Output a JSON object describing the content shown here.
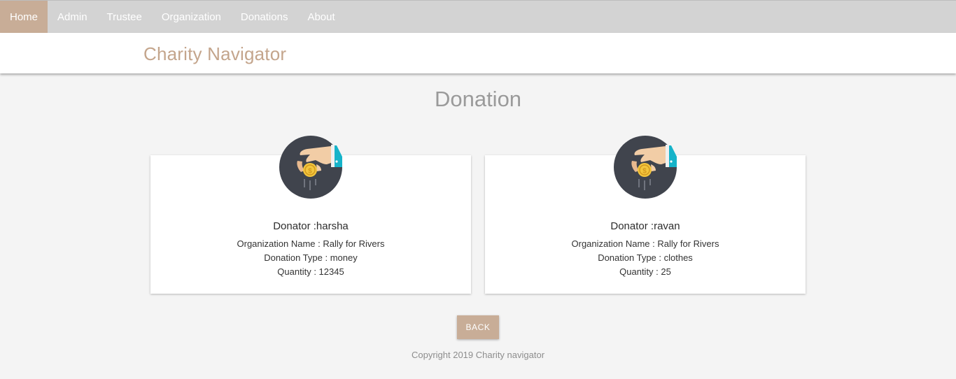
{
  "nav": {
    "items": [
      {
        "label": "Home",
        "active": true
      },
      {
        "label": "Admin"
      },
      {
        "label": "Trustee"
      },
      {
        "label": "Organization"
      },
      {
        "label": "Donations"
      },
      {
        "label": "About"
      }
    ]
  },
  "header": {
    "brand": "Charity Navigator"
  },
  "main": {
    "title": "Donation",
    "cards": [
      {
        "icon": "hand-coin-icon",
        "donor": "Donator :harsha",
        "organization": "Organization Name : Rally for Rivers",
        "type": "Donation Type : money",
        "quantity": "Quantity : 12345"
      },
      {
        "icon": "hand-coin-icon",
        "donor": "Donator :ravan",
        "organization": "Organization Name : Rally for Rivers",
        "type": "Donation Type : clothes",
        "quantity": "Quantity : 25"
      }
    ],
    "back_label": "BACK"
  },
  "footer": {
    "copyright": "Copyright 2019 Charity navigator"
  },
  "colors": {
    "accent": "#c8ad97",
    "brand": "#c4a58c",
    "nav_bg": "#d3d3d3",
    "icon_bg": "#40444d",
    "cuff": "#16b3c9",
    "coin": "#f3c63d"
  }
}
